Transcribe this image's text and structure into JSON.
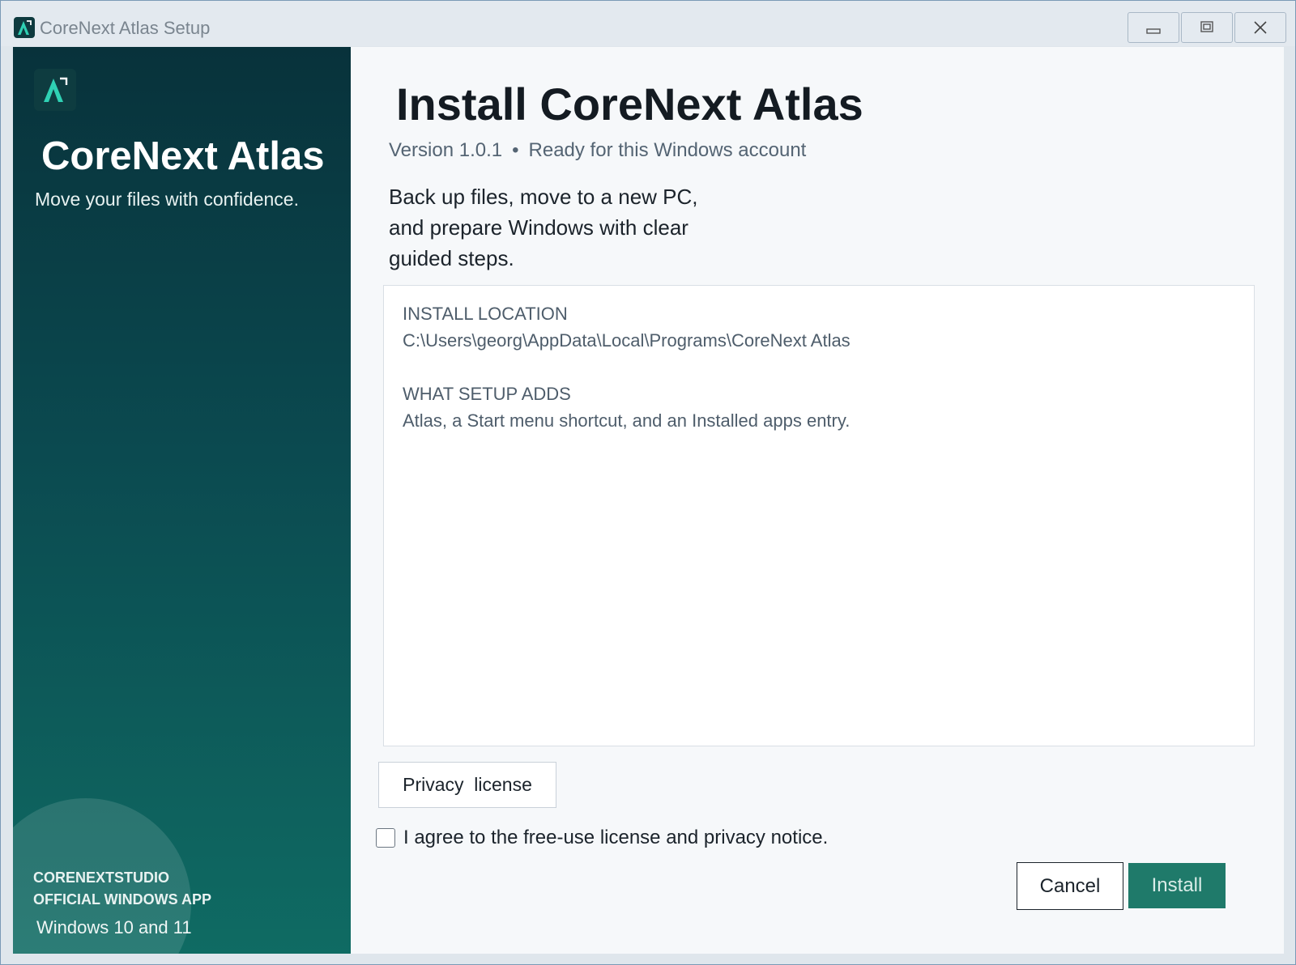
{
  "window": {
    "title": "CoreNext Atlas Setup",
    "controls": {
      "minimize": "minimize",
      "maximize": "maximize",
      "close": "close"
    }
  },
  "sidebar": {
    "app_name": "CoreNext Atlas",
    "tagline": "Move your files with confidence.",
    "publisher": "CORENEXTSTUDIO",
    "badge": "OFFICIAL WINDOWS APP",
    "compatibility": "Windows 10 and 11",
    "accent_color": "#2fd1b4"
  },
  "main": {
    "title": "Install CoreNext Atlas",
    "version": "Version 1.0.1",
    "separator": "•",
    "status": "Ready for this Windows account",
    "intro": "Back up files, move to a new PC, and prepare Windows with clear guided steps.",
    "install_location_label": "INSTALL LOCATION",
    "install_location_value": "C:\\Users\\georg\\AppData\\Local\\Programs\\CoreNext Atlas",
    "adds_label": "WHAT SETUP ADDS",
    "adds_value": "Atlas, a Start menu shortcut, and an Installed apps entry.",
    "privacy_button": "Privacy  license",
    "agree_text": "I agree to the free-use license and privacy notice.",
    "agree_checked": false,
    "cancel_button": "Cancel",
    "install_button": "Install",
    "install_color": "#1f7a6a"
  }
}
